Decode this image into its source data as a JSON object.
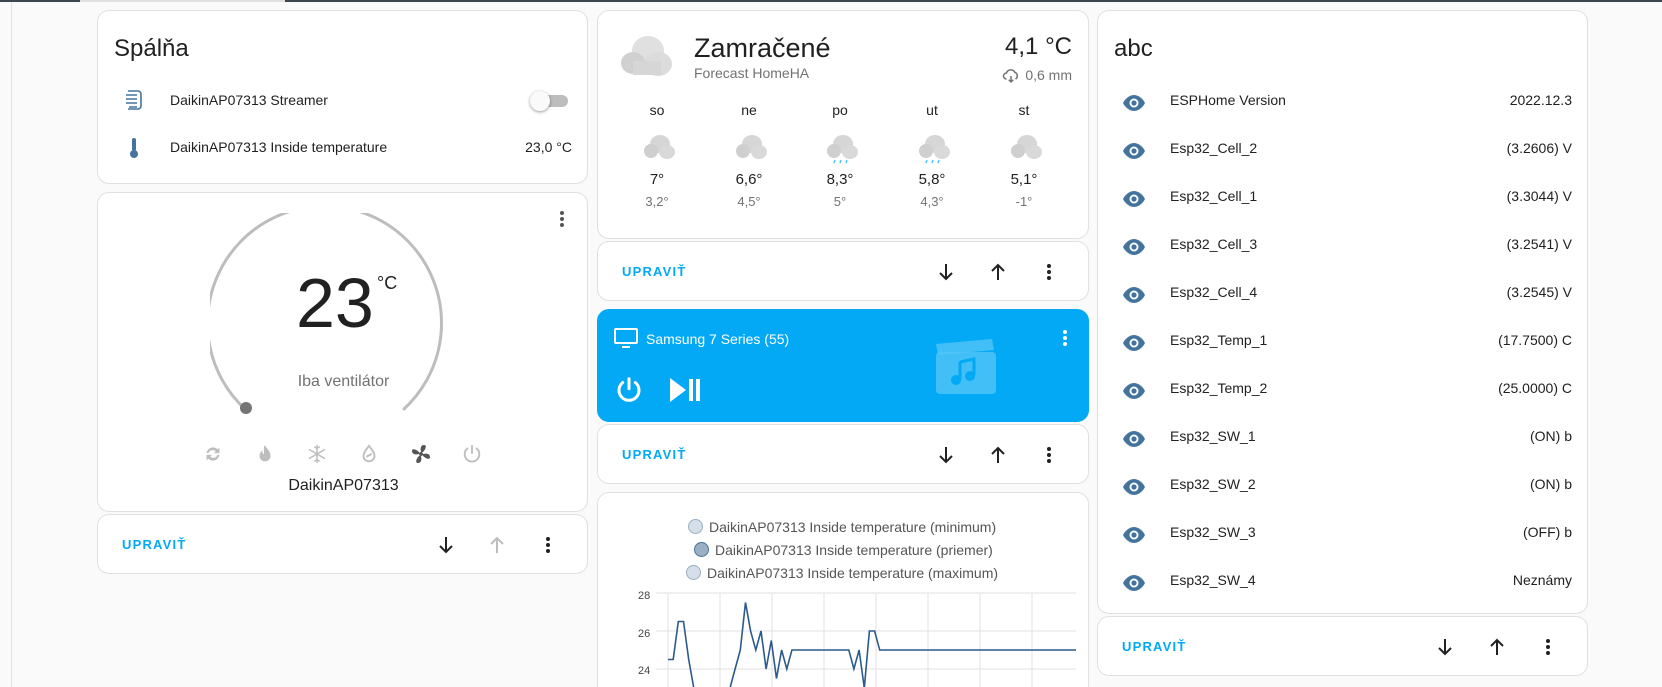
{
  "bedroom": {
    "title": "Spálňa",
    "rows": [
      {
        "label": "DaikinAP07313 Streamer",
        "icon": "air-purifier-icon",
        "value": ""
      },
      {
        "label": "DaikinAP07313 Inside temperature",
        "icon": "thermometer-icon",
        "value": "23,0 °C"
      }
    ]
  },
  "thermostat": {
    "temperature": "23",
    "unit": "°C",
    "mode": "Iba ventilátor",
    "name": "DaikinAP07313",
    "modes": [
      "heat-cool",
      "heat",
      "cool",
      "dry",
      "fan-only",
      "off"
    ],
    "active_mode": "fan-only"
  },
  "weather": {
    "condition": "Zamračené",
    "source": "Forecast HomeHA",
    "temperature": "4,1 °C",
    "precipitation": "0,6 mm",
    "forecast": [
      {
        "day": "so",
        "hi": "7°",
        "lo": "3,2°",
        "icon": "cloudy"
      },
      {
        "day": "ne",
        "hi": "6,6°",
        "lo": "4,5°",
        "icon": "cloudy"
      },
      {
        "day": "po",
        "hi": "8,3°",
        "lo": "5°",
        "icon": "rainy"
      },
      {
        "day": "ut",
        "hi": "5,8°",
        "lo": "4,3°",
        "icon": "rainy"
      },
      {
        "day": "st",
        "hi": "5,1°",
        "lo": "-1°",
        "icon": "cloudy"
      }
    ]
  },
  "media": {
    "title": "Samsung 7 Series (55)",
    "accent": "#03a9f4"
  },
  "footer": {
    "edit_label": "UPRAVIŤ"
  },
  "abc": {
    "title": "abc",
    "rows": [
      {
        "label": "ESPHome Version",
        "value": "2022.12.3"
      },
      {
        "label": "Esp32_Cell_2",
        "value": "(3.2606) V"
      },
      {
        "label": "Esp32_Cell_1",
        "value": "(3.3044) V"
      },
      {
        "label": "Esp32_Cell_3",
        "value": "(3.2541) V"
      },
      {
        "label": "Esp32_Cell_4",
        "value": "(3.2545) V"
      },
      {
        "label": "Esp32_Temp_1",
        "value": "(17.7500) C"
      },
      {
        "label": "Esp32_Temp_2",
        "value": "(25.0000) C"
      },
      {
        "label": "Esp32_SW_1",
        "value": "(ON) b"
      },
      {
        "label": "Esp32_SW_2",
        "value": "(ON) b"
      },
      {
        "label": "Esp32_SW_3",
        "value": "(OFF) b"
      },
      {
        "label": "Esp32_SW_4",
        "value": "Neznámy"
      }
    ]
  },
  "chart_data": {
    "type": "line",
    "series": [
      {
        "name": "DaikinAP07313 Inside temperature (minimum)",
        "color": "#d6dee8"
      },
      {
        "name": "DaikinAP07313 Inside temperature (priemer)",
        "color": "#9aaec4"
      },
      {
        "name": "DaikinAP07313 Inside temperature (maximum)",
        "color": "#d6dee8"
      }
    ],
    "yticks": [
      "28",
      "26",
      "24"
    ],
    "ylim": [
      23,
      28
    ],
    "values": [
      24.5,
      24.5,
      26.5,
      26.5,
      24.5,
      23,
      23,
      23,
      23,
      23,
      23,
      23,
      23,
      24,
      25,
      27.5,
      26,
      25,
      26,
      24,
      25.5,
      23.5,
      25,
      24,
      25,
      25,
      25,
      25,
      25,
      25,
      25,
      25,
      25,
      25,
      25,
      25,
      24,
      25,
      23,
      26,
      26,
      25,
      25,
      25,
      25,
      25,
      25,
      25,
      25,
      25,
      25,
      25,
      25,
      25,
      25,
      25,
      25,
      25,
      25,
      25,
      25,
      25,
      25,
      25,
      25,
      25,
      25,
      25,
      25,
      25,
      25,
      25,
      25,
      25,
      25,
      25,
      25,
      25,
      25,
      25
    ],
    "line_color": "#2c5a8c",
    "grid": true
  }
}
